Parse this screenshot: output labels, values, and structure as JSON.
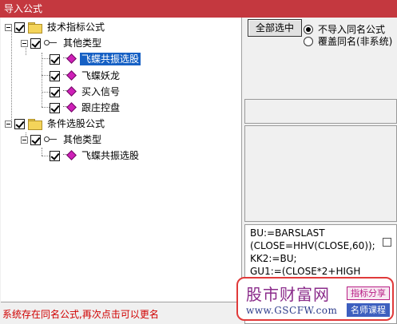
{
  "window": {
    "title": "导入公式"
  },
  "tree": {
    "root1": {
      "label": "技术指标公式",
      "group": {
        "label": "其他类型",
        "items": [
          {
            "label": "飞蝶共振选股",
            "selected": true
          },
          {
            "label": "飞蝶妖龙"
          },
          {
            "label": "买入信号"
          },
          {
            "label": "跟庄控盘"
          }
        ]
      }
    },
    "root2": {
      "label": "条件选股公式",
      "group": {
        "label": "其他类型",
        "items": [
          {
            "label": "飞蝶共振选股"
          }
        ]
      }
    }
  },
  "options": {
    "select_all_label": "全部选中",
    "radio_skip_label": "不导入同名公式",
    "radio_overwrite_label": "覆盖同名(非系统)",
    "selected_radio": "radio_skip"
  },
  "code": {
    "text": "BU:=BARSLAST\n(CLOSE=HHV(CLOSE,60));\nKK2:=BU;\nGU1:=(CLOSE*2+HIGH"
  },
  "status": {
    "message": "系统存在同名公式,再次点击可以更名"
  },
  "watermark": {
    "name": "股市财富网",
    "url": "www.GSCFW.com",
    "tag1": "指标分享",
    "tag2": "名师课程"
  },
  "colors": {
    "titlebar": "#c4383f",
    "selection": "#1660c4",
    "status_text": "#d00000",
    "gem_icon": "#cf1fb8",
    "folder_icon": "#f4d45a"
  }
}
